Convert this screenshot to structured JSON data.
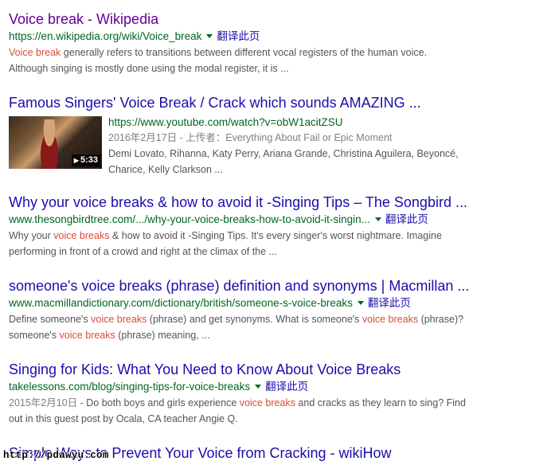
{
  "translate_label": "翻译此页",
  "results": [
    {
      "title": "Voice break - Wikipedia",
      "url": "https://en.wikipedia.org/wiki/Voice_break",
      "snippet_line1_hl": "Voice break",
      "snippet_line1_rest": " generally refers to transitions between different vocal registers of the human voice.",
      "snippet_line2": "Although singing is mostly done using the modal register, it is ..."
    },
    {
      "title": "Famous Singers' Voice Break / Crack which sounds AMAZING ...",
      "url": "https://www.youtube.com/watch?v=obW1acitZSU",
      "meta": "2016年2月17日 - 上传者：Everything About Fail or Epic Moment",
      "desc_line1": "Demi Lovato, Rihanna, Katy Perry, Ariana Grande, Christina Aguilera, Beyoncé,",
      "desc_line2": "Charice, Kelly Clarkson ...",
      "duration": "5:33",
      "play_icon": "▶"
    },
    {
      "title": "Why your voice breaks & how to avoid it -Singing Tips – The Songbird ...",
      "url": "www.thesongbirdtree.com/.../why-your-voice-breaks-how-to-avoid-it-singin...",
      "s1a": "Why your ",
      "s1hl": "voice breaks",
      "s1b": " & how to avoid it -Singing Tips. It's every singer's worst nightmare. Imagine",
      "s2": "performing in front of a crowd and right at the climax of the ..."
    },
    {
      "title": "someone's voice breaks (phrase) definition and synonyms | Macmillan ...",
      "url": "www.macmillandictionary.com/dictionary/british/someone-s-voice-breaks",
      "s1a": "Define someone's ",
      "s1hl": "voice breaks",
      "s1b": " (phrase) and get synonyms. What is someone's ",
      "s1hl2": "voice breaks",
      "s1c": " (phrase)?",
      "s2a": "someone's ",
      "s2hl": "voice breaks",
      "s2b": " (phrase) meaning, ..."
    },
    {
      "title": "Singing for Kids: What You Need to Know About Voice Breaks",
      "url": "takelessons.com/blog/singing-tips-for-voice-breaks",
      "date": "2015年2月10日",
      "s1a": " - Do both boys and girls experience ",
      "s1hl": "voice breaks",
      "s1b": " and cracks as they learn to sing? Find",
      "s2": "out in this guest post by Ocala, CA teacher Angie Q."
    },
    {
      "title": "Simple Ways to Prevent Your Voice from Cracking - wikiHow"
    }
  ],
  "watermark": "http://pdawyu.com"
}
